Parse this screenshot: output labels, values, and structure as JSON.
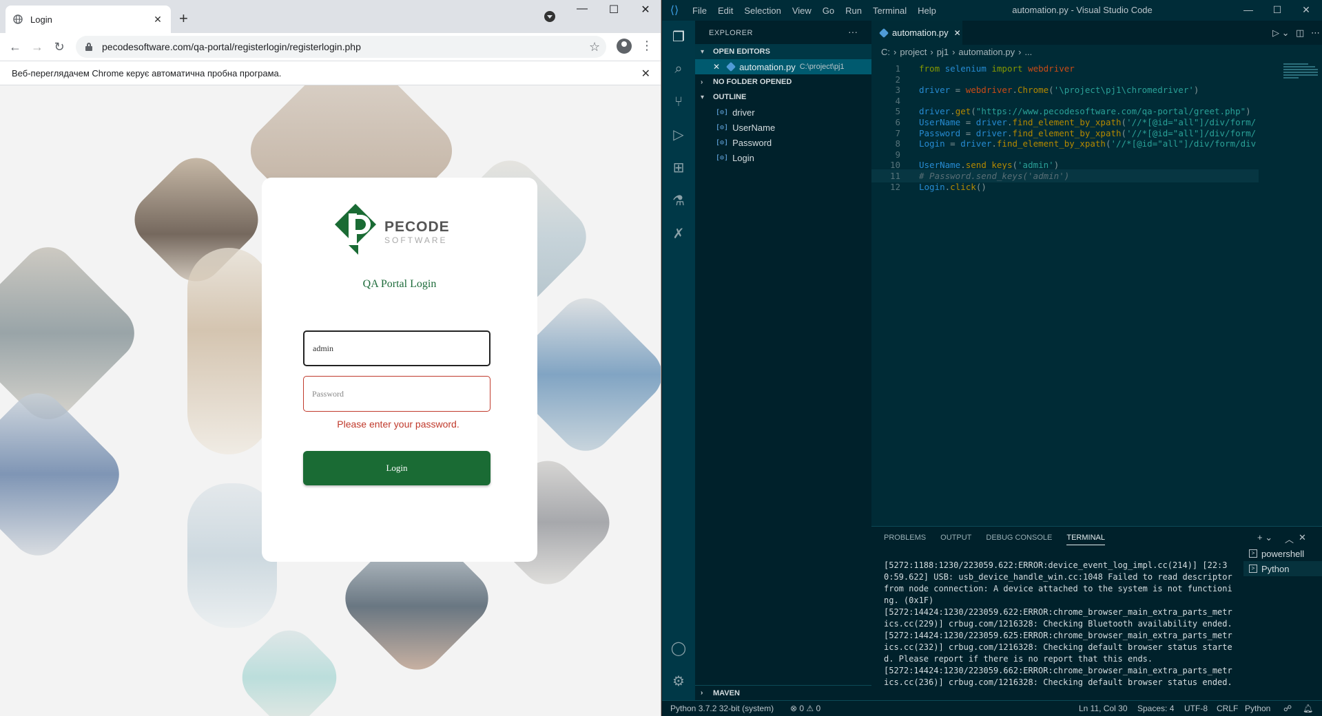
{
  "browser": {
    "tab_title": "Login",
    "url": "pecodesoftware.com/qa-portal/registerlogin/registerlogin.php",
    "infobar_text": "Веб-переглядачем Chrome керує автоматична пробна програма.",
    "page": {
      "brand_name": "PECODE",
      "brand_sub": "SOFTWARE",
      "heading": "QA Portal Login",
      "username_value": "admin",
      "password_placeholder": "Password",
      "error": "Please enter your password.",
      "login_button": "Login"
    }
  },
  "vscode": {
    "window_title": "automation.py - Visual Studio Code",
    "menu": [
      "File",
      "Edit",
      "Selection",
      "View",
      "Go",
      "Run",
      "Terminal",
      "Help"
    ],
    "explorer_title": "EXPLORER",
    "sections": {
      "open_editors": "OPEN EDITORS",
      "no_folder": "NO FOLDER OPENED",
      "outline": "OUTLINE",
      "maven": "MAVEN"
    },
    "open_editor": {
      "file": "automation.py",
      "path": "C:\\project\\pj1"
    },
    "outline_items": [
      "driver",
      "UserName",
      "Password",
      "Login"
    ],
    "editor_tab": "automation.py",
    "breadcrumb": [
      "C:",
      "project",
      "pj1",
      "automation.py",
      "..."
    ],
    "code_lines": [
      {
        "n": "1",
        "parts": [
          [
            "kw",
            "from "
          ],
          [
            "var",
            "selenium"
          ],
          [
            "kw",
            " import "
          ],
          [
            "op",
            "webdriver"
          ]
        ]
      },
      {
        "n": "2",
        "parts": []
      },
      {
        "n": "3",
        "parts": [
          [
            "var",
            "driver"
          ],
          [
            "",
            " = "
          ],
          [
            "op",
            "webdriver"
          ],
          [
            "",
            "."
          ],
          [
            "fn",
            "Chrome"
          ],
          [
            "",
            "("
          ],
          [
            "str",
            "'\\project\\pj1\\chromedriver'"
          ],
          [
            "",
            ")"
          ]
        ]
      },
      {
        "n": "4",
        "parts": []
      },
      {
        "n": "5",
        "parts": [
          [
            "var",
            "driver"
          ],
          [
            "",
            "."
          ],
          [
            "fn",
            "get"
          ],
          [
            "",
            "("
          ],
          [
            "str",
            "\"https://www.pecodesoftware.com/qa-portal/greet.php\""
          ],
          [
            "",
            ")"
          ]
        ]
      },
      {
        "n": "6",
        "parts": [
          [
            "var",
            "UserName"
          ],
          [
            "",
            " = "
          ],
          [
            "var",
            "driver"
          ],
          [
            "",
            "."
          ],
          [
            "fn",
            "find_element_by_xpath"
          ],
          [
            "",
            "("
          ],
          [
            "str",
            "'//*[@id=\"all\"]/div/form/"
          ]
        ]
      },
      {
        "n": "7",
        "parts": [
          [
            "var",
            "Password"
          ],
          [
            "",
            " = "
          ],
          [
            "var",
            "driver"
          ],
          [
            "",
            "."
          ],
          [
            "fn",
            "find_element_by_xpath"
          ],
          [
            "",
            "("
          ],
          [
            "str",
            "'//*[@id=\"all\"]/div/form/"
          ]
        ]
      },
      {
        "n": "8",
        "parts": [
          [
            "var",
            "Login"
          ],
          [
            "",
            " = "
          ],
          [
            "var",
            "driver"
          ],
          [
            "",
            "."
          ],
          [
            "fn",
            "find_element_by_xpath"
          ],
          [
            "",
            "("
          ],
          [
            "str",
            "'//*[@id=\"all\"]/div/form/div"
          ]
        ]
      },
      {
        "n": "9",
        "parts": []
      },
      {
        "n": "10",
        "parts": [
          [
            "var",
            "UserName"
          ],
          [
            "",
            "."
          ],
          [
            "fn",
            "send_keys"
          ],
          [
            "",
            "("
          ],
          [
            "str",
            "'admin'"
          ],
          [
            "",
            ")"
          ]
        ]
      },
      {
        "n": "11",
        "parts": [
          [
            "cm",
            "# Password.send_keys('admin')"
          ]
        ]
      },
      {
        "n": "12",
        "parts": [
          [
            "var",
            "Login"
          ],
          [
            "",
            "."
          ],
          [
            "fn",
            "click"
          ],
          [
            "",
            "()"
          ]
        ]
      }
    ],
    "panel_tabs": [
      "PROBLEMS",
      "OUTPUT",
      "DEBUG CONSOLE",
      "TERMINAL"
    ],
    "terminal_text": "[5272:1188:1230/223059.622:ERROR:device_event_log_impl.cc(214)] [22:30:59.622] USB: usb_device_handle_win.cc:1048 Failed to read descriptor from node connection: A device attached to the system is not functioning. (0x1F)\n[5272:14424:1230/223059.622:ERROR:chrome_browser_main_extra_parts_metrics.cc(229)] crbug.com/1216328: Checking Bluetooth availability ended.\n[5272:14424:1230/223059.625:ERROR:chrome_browser_main_extra_parts_metrics.cc(232)] crbug.com/1216328: Checking default browser status started. Please report if there is no report that this ends.\n[5272:14424:1230/223059.662:ERROR:chrome_browser_main_extra_parts_metrics.cc(236)] crbug.com/1216328: Checking default browser status ended.",
    "terminals": [
      "powershell",
      "Python"
    ],
    "status": {
      "interpreter": "Python 3.7.2 32-bit (system)",
      "problems": "⊗ 0 ⚠ 0",
      "position": "Ln 11, Col 30",
      "spaces": "Spaces: 4",
      "encoding": "UTF-8",
      "eol": "CRLF",
      "language": "Python"
    },
    "colors": {
      "accent": "#1a6b34",
      "error": "#c0392b",
      "vscode_bg": "#002b36"
    }
  }
}
